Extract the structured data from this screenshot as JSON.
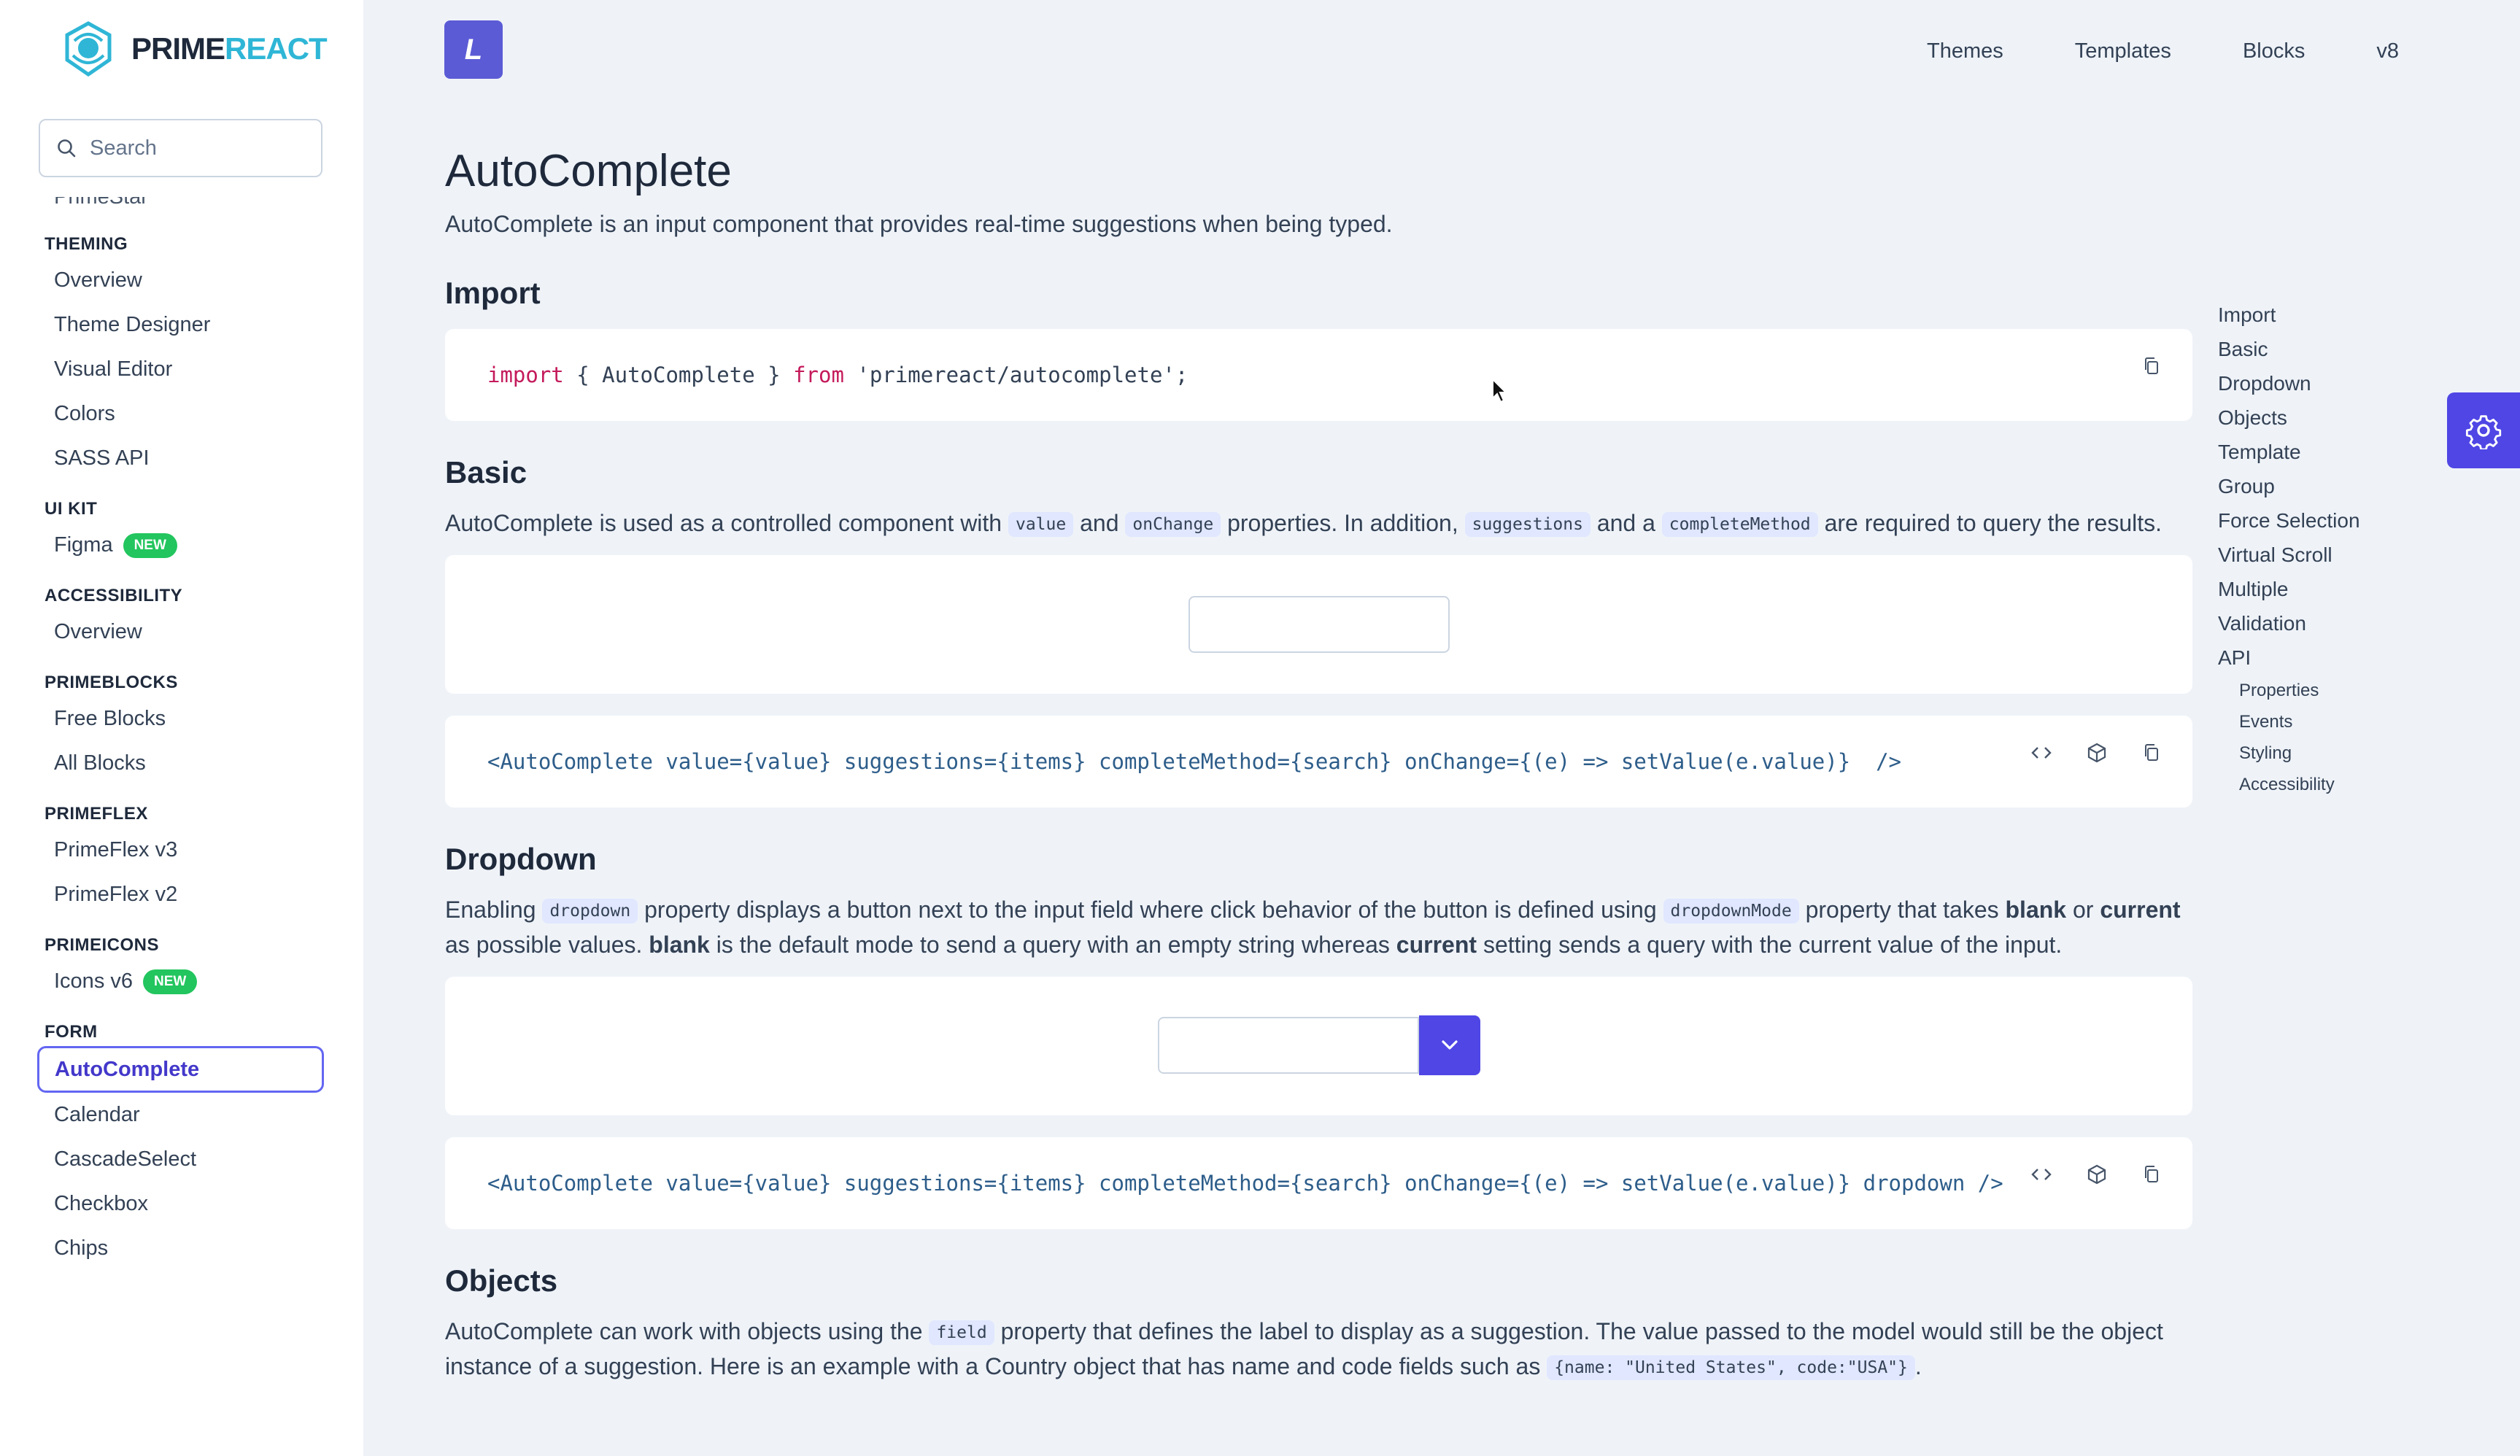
{
  "app": {
    "brand_prefix": "PRIME",
    "brand_suffix": "REACT",
    "brand_square_letter": "L"
  },
  "search": {
    "placeholder": "Search"
  },
  "topnav": [
    "Themes",
    "Templates",
    "Blocks",
    "v8"
  ],
  "sidebar": {
    "cut_item": "PrimeStar",
    "sections": [
      {
        "title": "THEMING",
        "items": [
          {
            "label": "Overview"
          },
          {
            "label": "Theme Designer"
          },
          {
            "label": "Visual Editor"
          },
          {
            "label": "Colors"
          },
          {
            "label": "SASS API"
          }
        ]
      },
      {
        "title": "UI KIT",
        "items": [
          {
            "label": "Figma",
            "badge": "NEW"
          }
        ]
      },
      {
        "title": "ACCESSIBILITY",
        "items": [
          {
            "label": "Overview"
          }
        ]
      },
      {
        "title": "PRIMEBLOCKS",
        "items": [
          {
            "label": "Free Blocks"
          },
          {
            "label": "All Blocks"
          }
        ]
      },
      {
        "title": "PRIMEFLEX",
        "items": [
          {
            "label": "PrimeFlex v3"
          },
          {
            "label": "PrimeFlex v2"
          }
        ]
      },
      {
        "title": "PRIMEICONS",
        "items": [
          {
            "label": "Icons v6",
            "badge": "NEW"
          }
        ]
      },
      {
        "title": "FORM",
        "items": [
          {
            "label": "AutoComplete",
            "active": true
          },
          {
            "label": "Calendar"
          },
          {
            "label": "CascadeSelect"
          },
          {
            "label": "Checkbox"
          },
          {
            "label": "Chips"
          }
        ]
      }
    ]
  },
  "page": {
    "title": "AutoComplete",
    "intro": "AutoComplete is an input component that provides real-time suggestions when being typed.",
    "import": {
      "heading": "Import",
      "code": {
        "kw1": "import",
        "open": "{",
        "name": " AutoComplete ",
        "close": "}",
        "kw2": "from",
        "module": "'primereact/autocomplete';"
      }
    },
    "basic": {
      "heading": "Basic",
      "text_1": "AutoComplete is used as a controlled component with ",
      "chip_1": "value",
      "text_2": " and ",
      "chip_2": "onChange",
      "text_3": " properties. In addition, ",
      "chip_3": "suggestions",
      "text_4": " and a ",
      "chip_4": "completeMethod",
      "text_5": " are required to query the results.",
      "code": "<AutoComplete value={value} suggestions={items} completeMethod={search} onChange={(e) => setValue(e.value)}  />"
    },
    "dropdown": {
      "heading": "Dropdown",
      "text_1": "Enabling ",
      "chip_1": "dropdown",
      "text_2": " property displays a button next to the input field where click behavior of the button is defined using ",
      "chip_2": "dropdownMode",
      "text_3": " property that takes ",
      "bold_1": "blank",
      "text_4": " or ",
      "bold_2": "current",
      "text_5": " as possible values. ",
      "bold_3": "blank",
      "text_6": " is the default mode to send a query with an empty string whereas ",
      "bold_4": "current",
      "text_7": " setting sends a query with the current value of the input.",
      "code": "<AutoComplete value={value} suggestions={items} completeMethod={search} onChange={(e) => setValue(e.value)} dropdown />"
    },
    "objects": {
      "heading": "Objects",
      "text_1": "AutoComplete can work with objects using the ",
      "chip_1": "field",
      "text_2": " property that defines the label to display as a suggestion. The value passed to the model would still be the object instance of a suggestion. Here is an example with a Country object that has name and code fields such as ",
      "chip_2": "{name: \"United States\", code:\"USA\"}",
      "text_3": "."
    }
  },
  "toc": {
    "items": [
      "Import",
      "Basic",
      "Dropdown",
      "Objects",
      "Template",
      "Group",
      "Force Selection",
      "Virtual Scroll",
      "Multiple",
      "Validation",
      "API"
    ],
    "sub_items": [
      "Properties",
      "Events",
      "Styling",
      "Accessibility"
    ]
  },
  "icons": {
    "search": "search-icon",
    "copy": "copy-icon",
    "code": "code-icon",
    "sandbox": "cube-icon",
    "chevron": "chevron-down-icon",
    "config": "gear-icon"
  },
  "colors": {
    "accent": "#4f46e5",
    "chip_bg": "#e0e7ff",
    "badge_green": "#22c55e",
    "logo_cyan": "#2fb6d6"
  }
}
